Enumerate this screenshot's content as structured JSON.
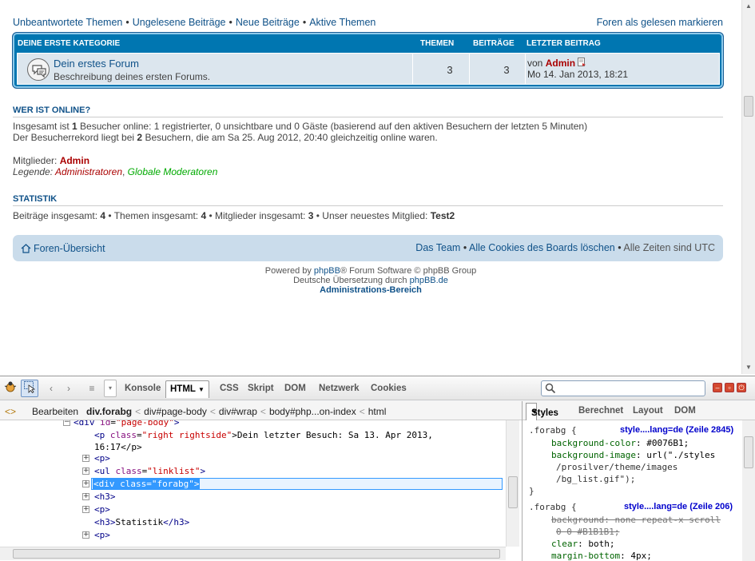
{
  "page": {
    "topnav": {
      "links": [
        "Unbeantwortete Themen",
        "Ungelesene Beiträge",
        "Neue Beiträge",
        "Aktive Themen"
      ],
      "separator": "•",
      "mark_read": "Foren als gelesen markieren"
    },
    "category": {
      "name": "Deine erste Kategorie",
      "col_topics": "Themen",
      "col_posts": "Beiträge",
      "col_lastpost": "Letzter Beitrag",
      "forum": {
        "title": "Dein erstes Forum",
        "description": "Beschreibung deines ersten Forums.",
        "topics": "3",
        "posts": "3",
        "last_by_prefix": "von",
        "last_author": "Admin",
        "last_date": "Mo 14. Jan 2013, 18:21"
      }
    },
    "online": {
      "title": "Wer ist online?",
      "line1_a": "Insgesamt ist ",
      "line1_n": "1",
      "line1_b": " Besucher online: 1 registrierter, 0 unsichtbare und 0 Gäste (basierend auf den aktiven Besuchern der letzten 5 Minuten)",
      "line2_a": "Der Besucherrekord liegt bei ",
      "line2_n": "2",
      "line2_b": " Besuchern, die am Sa 25. Aug 2012, 20:40 gleichzeitig online waren.",
      "members_label": "Mitglieder: ",
      "members_value": "Admin",
      "legend_label": "Legende: ",
      "legend_admins": "Administratoren",
      "legend_comma": ", ",
      "legend_mods": "Globale Moderatoren"
    },
    "stats": {
      "title": "Statistik",
      "posts_label": "Beiträge insgesamt: ",
      "posts": "4",
      "topics_label": " • Themen insgesamt: ",
      "topics": "4",
      "members_label": " • Mitglieder insgesamt: ",
      "members": "3",
      "newest_label": " • Unser neuestes Mitglied: ",
      "newest": "Test2"
    },
    "navbar": {
      "home": "Foren-Übersicht",
      "team": "Das Team",
      "cookies": "Alle Cookies des Boards löschen",
      "sep": " • ",
      "timezone": "Alle Zeiten sind UTC"
    },
    "footer": {
      "powered_a": "Powered by ",
      "powered_link": "phpBB",
      "powered_b": "® Forum Software © phpBB Group",
      "translation_a": "Deutsche Übersetzung durch ",
      "translation_link": "phpBB.de",
      "admin_link": "Administrations-Bereich"
    }
  },
  "firebug": {
    "tabs": [
      "Konsole",
      "HTML",
      "CSS",
      "Skript",
      "DOM",
      "Netzwerk",
      "Cookies"
    ],
    "selected_tab": "HTML",
    "edit_label": "Bearbeiten",
    "breadcrumbs": [
      "div.forabg",
      "div#page-body",
      "div#wrap",
      "body#php...on-index",
      "html"
    ],
    "html_lines": {
      "l0_tag": "<div ",
      "l0_attr": "id",
      "l0_val": "\"page-body\"",
      "l0_end": ">",
      "l1_open": "<p ",
      "l1_attr": "class",
      "l1_val": "\"right rightside\"",
      "l1_text": ">Dein letzter Besuch: Sa 13. Apr 2013,",
      "l1_cont": "16:17</p>",
      "l2": "<p>",
      "l3_open": "<ul ",
      "l3_attr": "class",
      "l3_val": "\"linklist\"",
      "l3_end": ">",
      "l4": "<div class=\"forabg\">",
      "l5": "<h3>",
      "l6": "<p>",
      "l7_a": "<h3>",
      "l7_b": "Statistik",
      "l7_c": "</h3>",
      "l8": "<p>"
    },
    "side_tabs": [
      "Styles",
      "Berechnet",
      "Layout",
      "DOM"
    ],
    "selected_side_tab": "Styles",
    "css_rules": {
      "r1_selector": ".forabg {",
      "r1_source": "style....lang=de (Zeile 2845)",
      "r1_p1": "background-color",
      "r1_v1": ": #0076B1;",
      "r1_p2": "background-image",
      "r1_v2": ": url(\"./styles",
      "r1_v2b": "/prosilver/theme/images",
      "r1_v2c": "/bg_list.gif\");",
      "r1_close": "}",
      "r2_selector": ".forabg {",
      "r2_source": "style....lang=de (Zeile 206)",
      "r2_p1": "background",
      "r2_v1": ": none repeat-x scroll",
      "r2_v1b": "0 0 #B1B1B1;",
      "r2_p2": "clear",
      "r2_v2": ": both;",
      "r2_p3": "margin-bottom",
      "r2_v3": ": 4px;"
    }
  }
}
